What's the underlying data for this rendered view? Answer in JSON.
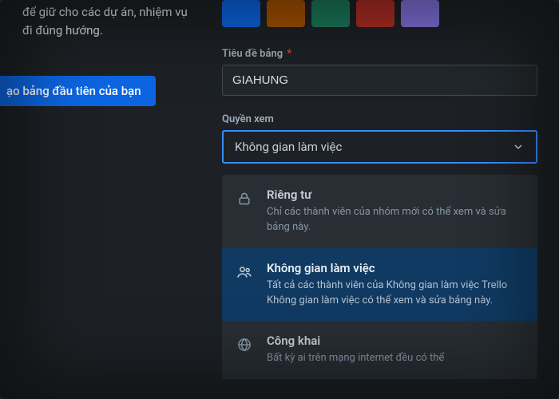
{
  "sidebar": {
    "blurb": "để giữ cho các dự án, nhiệm vụ đi đúng hướng.",
    "cta_label": "ạo bảng đầu tiên của bạn"
  },
  "swatches": [
    {
      "name": "blue",
      "hex": "#0c66e4"
    },
    {
      "name": "orange",
      "hex": "#a55200"
    },
    {
      "name": "green",
      "hex": "#1b7a5a"
    },
    {
      "name": "red",
      "hex": "#ae2e24"
    },
    {
      "name": "purple",
      "hex": "#6e5dc6"
    }
  ],
  "title_field": {
    "label": "Tiêu đề bảng",
    "required_marker": "*",
    "value": "GIAHUNG"
  },
  "visibility": {
    "label": "Quyền xem",
    "selected": "Không gian làm việc",
    "options": [
      {
        "key": "private",
        "title": "Riêng tư",
        "desc": "Chỉ các thành viên của nhóm mới có thể xem và sửa bảng này.",
        "icon": "lock"
      },
      {
        "key": "workspace",
        "title": "Không gian làm việc",
        "desc": "Tất cả các thành viên của Không gian làm việc Trello Không gian làm việc có thể xem và sửa bảng này.",
        "icon": "people",
        "selected": true
      },
      {
        "key": "public",
        "title": "Công khai",
        "desc": "Bất kỳ ai trên mạng internet đều có thể",
        "icon": "globe"
      }
    ]
  }
}
